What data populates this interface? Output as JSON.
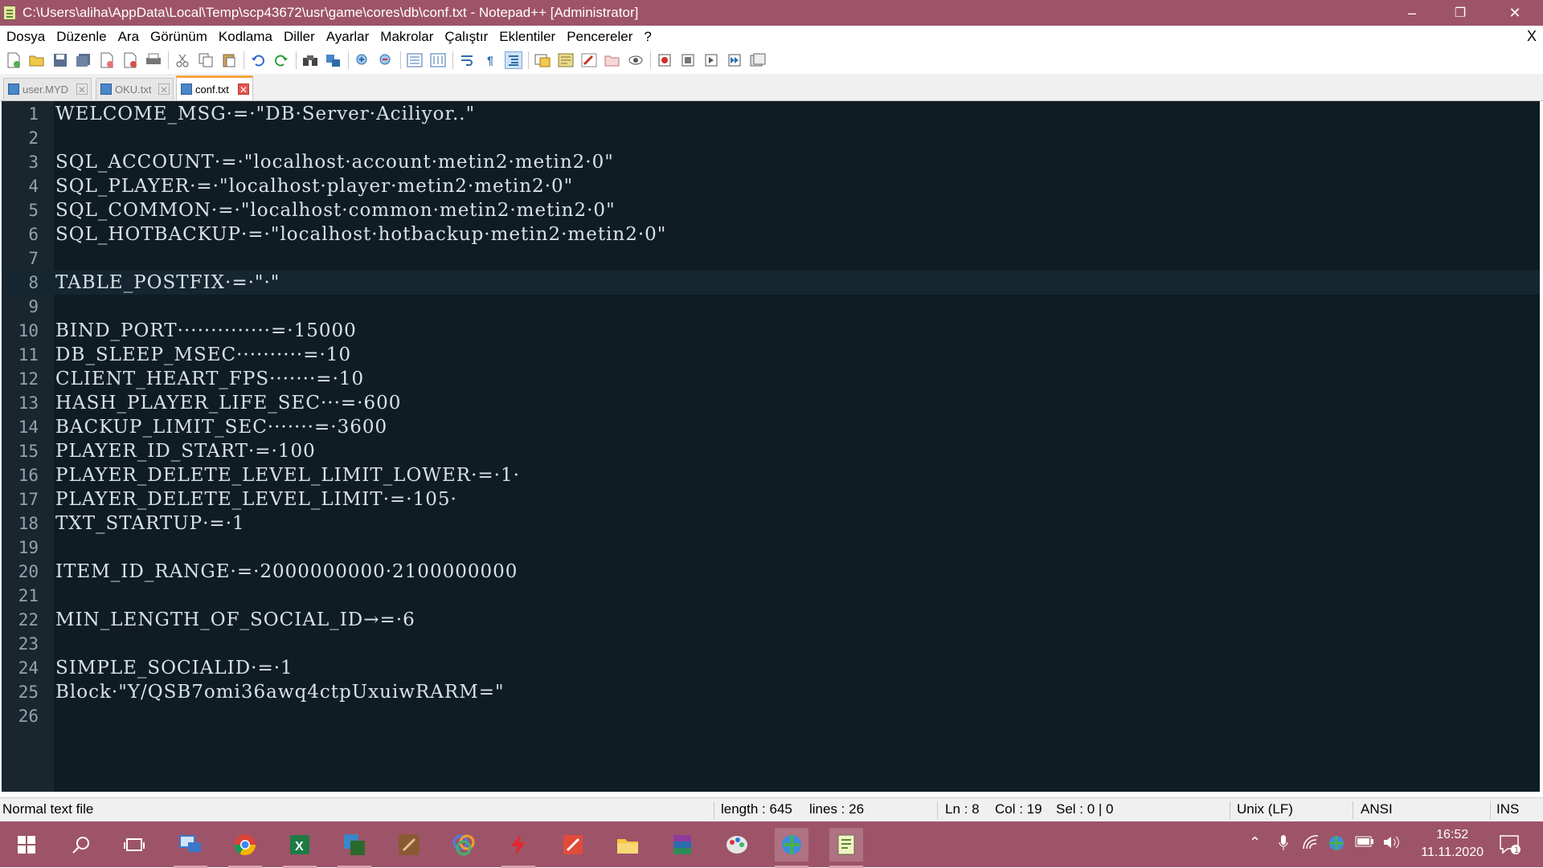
{
  "window": {
    "title": "C:\\Users\\aliha\\AppData\\Local\\Temp\\scp43672\\usr\\game\\cores\\db\\conf.txt - Notepad++ [Administrator]",
    "controls": {
      "minimize": "–",
      "maximize": "❐",
      "close": "✕"
    }
  },
  "menubar": {
    "items": [
      "Dosya",
      "Düzenle",
      "Ara",
      "Görünüm",
      "Kodlama",
      "Diller",
      "Ayarlar",
      "Makrolar",
      "Çalıştır",
      "Eklentiler",
      "Pencereler",
      "?"
    ],
    "close": "X"
  },
  "toolbar": {
    "icons": [
      "new-file-icon",
      "open-file-icon",
      "save-icon",
      "save-all-icon",
      "close-icon",
      "close-all-icon",
      "print-icon",
      "sep",
      "cut-icon",
      "copy-icon",
      "paste-icon",
      "sep",
      "undo-icon",
      "redo-icon",
      "sep",
      "find-icon",
      "replace-icon",
      "sep",
      "zoom-in-icon",
      "zoom-out-icon",
      "sep",
      "sync-vertical-icon",
      "sync-horizontal-icon",
      "sep",
      "word-wrap-icon",
      "show-all-chars-icon",
      "indent-guide-icon",
      "sep",
      "language-icon",
      "function-list-icon",
      "document-map-icon",
      "folder-workspace-icon",
      "monitor-icon",
      "sep",
      "record-macro-icon",
      "stop-macro-icon",
      "play-macro-icon",
      "run-macro-multiple-icon",
      "save-macro-icon"
    ]
  },
  "tabs": [
    {
      "label": "user.MYD",
      "active": false
    },
    {
      "label": "OKU.txt",
      "active": false
    },
    {
      "label": "conf.txt",
      "active": true
    }
  ],
  "editor": {
    "current_line": 8,
    "lines": [
      "WELCOME_MSG·=·\"DB·Server·Aciliyor..\"",
      "",
      "SQL_ACCOUNT·=·\"localhost·account·metin2·metin2·0\"",
      "SQL_PLAYER·=·\"localhost·player·metin2·metin2·0\"",
      "SQL_COMMON·=·\"localhost·common·metin2·metin2·0\"",
      "SQL_HOTBACKUP·=·\"localhost·hotbackup·metin2·metin2·0\"",
      "",
      "TABLE_POSTFIX·=·\"·\"",
      "",
      "BIND_PORT··············=·15000",
      "DB_SLEEP_MSEC··········=·10",
      "CLIENT_HEART_FPS·······=·10",
      "HASH_PLAYER_LIFE_SEC···=·600",
      "BACKUP_LIMIT_SEC·······=·3600",
      "PLAYER_ID_START·=·100",
      "PLAYER_DELETE_LEVEL_LIMIT_LOWER·=·1·",
      "PLAYER_DELETE_LEVEL_LIMIT·=·105·",
      "TXT_STARTUP·=·1",
      "",
      "ITEM_ID_RANGE·=·2000000000·2100000000",
      "",
      "MIN_LENGTH_OF_SOCIAL_ID→=·6",
      "",
      "SIMPLE_SOCIALID·=·1",
      "Block·\"Y/QSB7omi36awq4ctpUxuiwRARM=\"",
      ""
    ]
  },
  "statusbar": {
    "file_type": "Normal text file",
    "length": "length : 645",
    "lines": "lines : 26",
    "ln": "Ln : 8",
    "col": "Col : 19",
    "sel": "Sel : 0 | 0",
    "eol": "Unix (LF)",
    "encoding": "ANSI",
    "mode": "INS"
  },
  "taskbar": {
    "apps": [
      {
        "name": "start-button",
        "color": "#ffffff"
      },
      {
        "name": "search-button",
        "color": "#ffffff"
      },
      {
        "name": "task-view-button",
        "color": "#ffffff"
      },
      {
        "name": "remote-desktop-app",
        "color": "#3b78c8"
      },
      {
        "name": "chrome-app",
        "color": "#e0b53a"
      },
      {
        "name": "excel-app",
        "color": "#1f7a44"
      },
      {
        "name": "winscp-app",
        "color": "#3a86c9"
      },
      {
        "name": "game-app",
        "color": "#c7955e"
      },
      {
        "name": "colorful-app",
        "color": "#4f7de0"
      },
      {
        "name": "flash-app",
        "color": "#e3262e"
      },
      {
        "name": "pdf-app",
        "color": "#e24a3a"
      },
      {
        "name": "file-explorer-app",
        "color": "#f5c542"
      },
      {
        "name": "winrar-app",
        "color": "#8e3b9b"
      },
      {
        "name": "paint-app",
        "color": "#d9d9d9"
      },
      {
        "name": "network-app",
        "color": "#4bb04b"
      },
      {
        "name": "notepadpp-app",
        "color": "#b8d66a"
      }
    ],
    "tray_icons": [
      "chevron-up-icon",
      "microphone-icon",
      "wifi-icon",
      "network-globe-icon",
      "battery-icon",
      "volume-icon"
    ],
    "time": "16:52",
    "date": "11.11.2020",
    "notification_count": "1"
  }
}
